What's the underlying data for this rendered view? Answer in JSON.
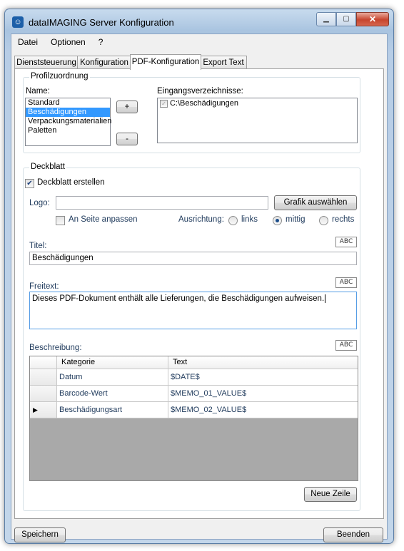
{
  "window": {
    "title": "dataIMAGING Server Konfiguration",
    "icon": "app-logo-icon"
  },
  "menu": [
    "Datei",
    "Optionen",
    "?"
  ],
  "tabs": [
    "Dienststeuerung",
    "Konfiguration",
    "PDF-Konfiguration",
    "Export Text"
  ],
  "active_tab": "PDF-Konfiguration",
  "profile": {
    "group_title": "Profilzuordnung",
    "name_label": "Name:",
    "names": [
      "Standard",
      "Beschädigungen",
      "Verpackungsmaterialien",
      "Paletten"
    ],
    "selected_name": "Beschädigungen",
    "add_button": "+",
    "remove_button": "-",
    "dirs_label": "Eingangsverzeichnisse:",
    "directories": [
      {
        "path": "C:\\Beschädigungen",
        "checked": true
      }
    ]
  },
  "cover": {
    "group_title": "Deckblatt",
    "create_label": "Deckblatt erstellen",
    "create_checked": true,
    "logo_label": "Logo:",
    "logo_value": "",
    "choose_graphic_button": "Grafik auswählen",
    "fit_label": "An Seite anpassen",
    "fit_checked": false,
    "align_label": "Ausrichtung:",
    "align_options": [
      "links",
      "mittig",
      "rechts"
    ],
    "align_selected": "mittig",
    "title_label": "Titel:",
    "title_value": "Beschädigungen",
    "freetext_label": "Freitext:",
    "freetext_value": "Dieses PDF-Dokument enthält alle Lieferungen, die Beschädigungen aufweisen.",
    "description_label": "Beschreibung:",
    "abc_label": "ABC",
    "grid": {
      "columns": [
        "Kategorie",
        "Text"
      ],
      "rows": [
        {
          "kategorie": "Datum",
          "text": "$DATE$",
          "marker": ""
        },
        {
          "kategorie": "Barcode-Wert",
          "text": "$MEMO_01_VALUE$",
          "marker": ""
        },
        {
          "kategorie": "Beschädigungsart",
          "text": "$MEMO_02_VALUE$",
          "marker": "▶"
        }
      ]
    },
    "new_row_button": "Neue Zeile"
  },
  "footer": {
    "save_button": "Speichern",
    "exit_button": "Beenden"
  }
}
